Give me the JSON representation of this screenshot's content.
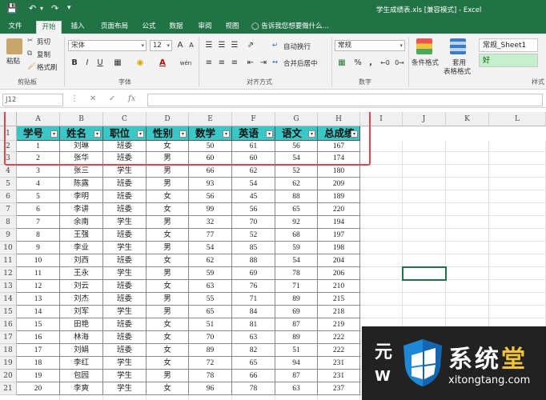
{
  "titlebar": {
    "title": "学生成绩表.xls [兼容模式] - Excel"
  },
  "tabs": [
    "文件",
    "开始",
    "插入",
    "页面布局",
    "公式",
    "数据",
    "审阅",
    "视图"
  ],
  "tell_me": "告诉我您想要做什么...",
  "ribbon": {
    "clipboard": {
      "paste": "粘贴",
      "cut": "剪切",
      "copy": "复制",
      "format_painter": "格式刷",
      "label": "剪贴板"
    },
    "font": {
      "name": "宋体",
      "size": "12",
      "bold": "B",
      "italic": "I",
      "underline": "U",
      "grow": "A",
      "shrink": "A",
      "font_color_letter": "A",
      "phonetic": "wén",
      "label": "字体"
    },
    "alignment": {
      "wrap": "自动换行",
      "merge": "合并后居中",
      "label": "对齐方式"
    },
    "number": {
      "format": "常规",
      "pct": "%",
      "comma": ",",
      "label": "数字"
    },
    "styles": {
      "conditional": "条件格式",
      "table": "套用",
      "table2": "表格格式",
      "style1": "常规_Sheet1",
      "style2": "好",
      "label": "样式"
    }
  },
  "formula_bar": {
    "name_box": "J12",
    "fx": "fx"
  },
  "columns": [
    "A",
    "B",
    "C",
    "D",
    "E",
    "F",
    "G",
    "H",
    "I",
    "J",
    "K",
    "L"
  ],
  "row_numbers": [
    "1",
    "2",
    "3",
    "4",
    "5",
    "6",
    "7",
    "8",
    "9",
    "10",
    "11",
    "12",
    "13",
    "14",
    "15",
    "16",
    "17",
    "18",
    "19",
    "20",
    "21"
  ],
  "table_headers": [
    "学号",
    "姓名",
    "职位",
    "性别",
    "数学",
    "英语",
    "语文",
    "总成绩"
  ],
  "rows": [
    [
      "1",
      "刘琳",
      "班委",
      "女",
      "50",
      "61",
      "56",
      "167"
    ],
    [
      "2",
      "张华",
      "班委",
      "男",
      "60",
      "60",
      "54",
      "174"
    ],
    [
      "3",
      "张三",
      "学生",
      "男",
      "66",
      "62",
      "52",
      "180"
    ],
    [
      "4",
      "陈露",
      "班委",
      "男",
      "93",
      "54",
      "62",
      "209"
    ],
    [
      "5",
      "李明",
      "班委",
      "女",
      "56",
      "45",
      "88",
      "189"
    ],
    [
      "6",
      "李讲",
      "班委",
      "女",
      "99",
      "56",
      "65",
      "220"
    ],
    [
      "7",
      "余南",
      "学生",
      "男",
      "32",
      "70",
      "92",
      "194"
    ],
    [
      "8",
      "王强",
      "班委",
      "女",
      "77",
      "52",
      "68",
      "197"
    ],
    [
      "9",
      "李业",
      "学生",
      "男",
      "54",
      "85",
      "59",
      "198"
    ],
    [
      "10",
      "刘西",
      "班委",
      "女",
      "62",
      "88",
      "54",
      "204"
    ],
    [
      "11",
      "王永",
      "学生",
      "男",
      "59",
      "69",
      "78",
      "206"
    ],
    [
      "12",
      "刘云",
      "班委",
      "女",
      "63",
      "76",
      "71",
      "210"
    ],
    [
      "13",
      "刘杰",
      "班委",
      "男",
      "55",
      "71",
      "89",
      "215"
    ],
    [
      "14",
      "刘军",
      "学生",
      "男",
      "65",
      "84",
      "69",
      "218"
    ],
    [
      "15",
      "田艳",
      "班委",
      "女",
      "51",
      "81",
      "87",
      "219"
    ],
    [
      "16",
      "林海",
      "班委",
      "女",
      "70",
      "63",
      "89",
      "222"
    ],
    [
      "17",
      "刘娟",
      "班委",
      "女",
      "89",
      "82",
      "51",
      "222"
    ],
    [
      "18",
      "李红",
      "学生",
      "女",
      "72",
      "65",
      "94",
      "231"
    ],
    [
      "19",
      "包园",
      "学生",
      "男",
      "78",
      "66",
      "87",
      "231"
    ],
    [
      "20",
      "李爽",
      "学生",
      "女",
      "96",
      "78",
      "63",
      "237"
    ]
  ],
  "watermark": {
    "brand_a": "系统",
    "brand_b": "堂",
    "url": "xitongtang.com",
    "partial_a": "元",
    "partial_b": "W"
  },
  "colors": {
    "excel_green": "#217346",
    "header_fill": "#3cc7c7",
    "highlight_red": "#e0474c"
  }
}
